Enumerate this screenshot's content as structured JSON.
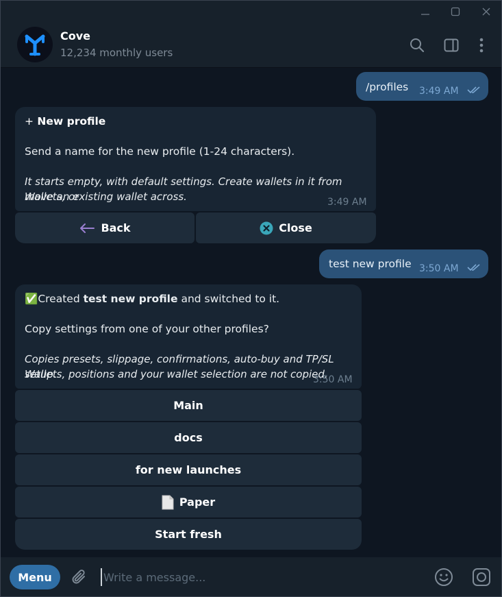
{
  "window": {
    "minimize_icon": "minimize-icon",
    "maximize_icon": "maximize-icon",
    "close_icon": "close-icon"
  },
  "header": {
    "name": "Cove",
    "subtitle": "12,234 monthly users",
    "icons": [
      "search-icon",
      "sidebar-toggle-icon",
      "more-vertical-icon"
    ]
  },
  "messages": [
    {
      "direction": "out",
      "text": "/profiles",
      "time": "3:49 AM",
      "status": "read"
    },
    {
      "direction": "in",
      "title_icon": "+",
      "title": "New profile",
      "body": "Send a name for the new profile (1-24 characters).",
      "note_line1": "It starts empty, with default settings. Create wallets in it from Wallets, or",
      "note_line2": "move an existing wallet across.",
      "time": "3:49 AM",
      "buttons": [
        {
          "label": "Back",
          "icon": "arrow-left-icon"
        },
        {
          "label": "Close",
          "icon": "close-circle-icon"
        }
      ]
    },
    {
      "direction": "out",
      "text": "test new profile",
      "time": "3:50 AM",
      "status": "read"
    },
    {
      "direction": "in",
      "check_icon": "✅",
      "created_prefix": "Created ",
      "created_name": "test new profile",
      "created_suffix": " and switched to it.",
      "question": "Copy settings from one of your other profiles?",
      "note_line1": "Copies presets, slippage, confirmations, auto-buy and TP/SL setup.",
      "note_line2": "Wallets, positions and your wallet selection are not copied.",
      "time": "3:50 AM",
      "buttons": [
        {
          "label": "Main"
        },
        {
          "label": "docs"
        },
        {
          "label": "for new launches"
        },
        {
          "label": "Paper",
          "icon": "document-icon"
        },
        {
          "label": "Start fresh"
        }
      ]
    }
  ],
  "composer": {
    "menu_label": "Menu",
    "placeholder": "Write a message...",
    "icons": [
      "attach-icon",
      "emoji-icon",
      "camera-icon"
    ]
  },
  "colors": {
    "background": "#0e1621",
    "panel": "#17212b",
    "outgoing": "#2b5278",
    "incoming": "#182533",
    "accent": "#2f6ea5"
  }
}
